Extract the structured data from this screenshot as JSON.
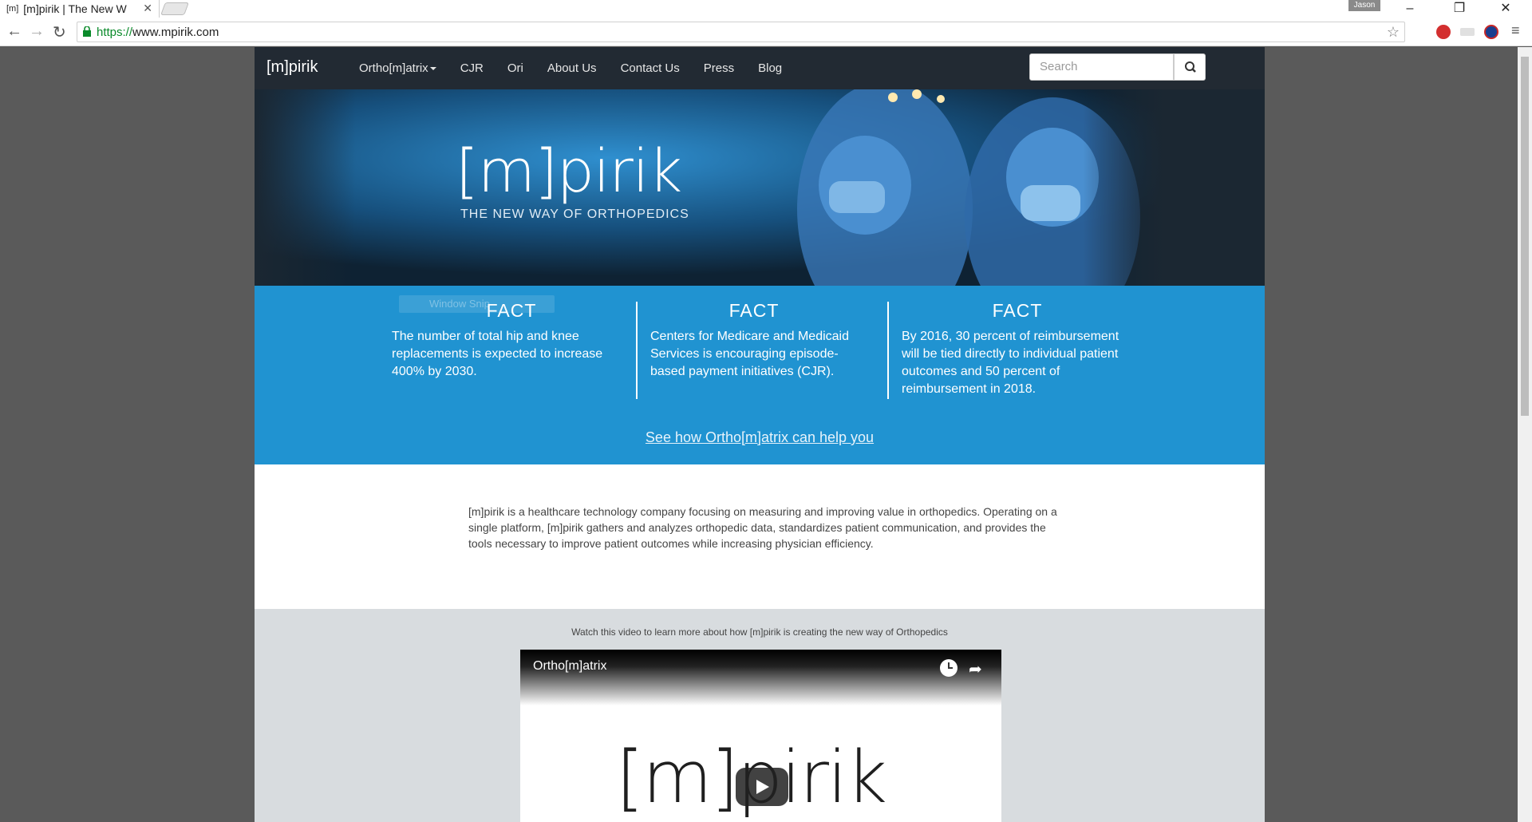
{
  "browser": {
    "tab_title": "[m]pirik | The New W",
    "tab_favicon": "[m]",
    "user_badge": "Jason",
    "url_protocol": "https://",
    "url_host": "www.mpirik.com"
  },
  "site": {
    "brand": "[m]pirik",
    "nav": [
      {
        "label": "Ortho[m]atrix",
        "dropdown": true
      },
      {
        "label": "CJR"
      },
      {
        "label": "Ori"
      },
      {
        "label": "About Us"
      },
      {
        "label": "Contact Us"
      },
      {
        "label": "Press"
      },
      {
        "label": "Blog"
      }
    ],
    "search_placeholder": "Search",
    "hero": {
      "logo": "[m]pirik",
      "tagline": "THE NEW WAY OF ORTHOPEDICS"
    },
    "facts": [
      {
        "heading": "FACT",
        "text": "The number of total hip and knee replacements is expected to increase 400% by 2030."
      },
      {
        "heading": "FACT",
        "text": "Centers for Medicare and Medicaid Services is encouraging episode-based payment initiatives (CJR)."
      },
      {
        "heading": "FACT",
        "text": "By 2016, 30 percent of reimbursement will be tied directly to individual patient outcomes and 50 percent of reimbursement in 2018."
      }
    ],
    "ghost_overlay": "Window Snip",
    "cta": "See how Ortho[m]atrix can help you",
    "about": "[m]pirik is a healthcare technology company focusing on measuring and improving value in orthopedics. Operating on a single platform, [m]pirik gathers and analyzes orthopedic data, standardizes patient communication, and provides the tools necessary to improve patient outcomes while increasing physician efficiency.",
    "video": {
      "caption": "Watch this video to learn more about how [m]pirik is creating the new way of Orthopedics",
      "title": "Ortho[m]atrix",
      "logo": "[m]pirik"
    }
  }
}
